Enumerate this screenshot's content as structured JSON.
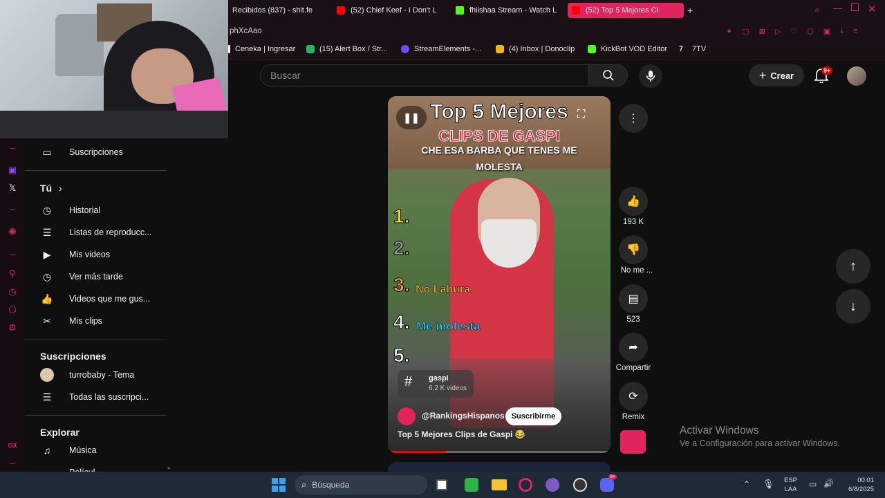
{
  "browser": {
    "tabs": [
      {
        "label": "Recibidos (837) - shit.fe"
      },
      {
        "label": "(52) Chief Keef - I Don't L"
      },
      {
        "label": "fhiishaa Stream - Watch L"
      },
      {
        "label": "(52) Top 5 Mejores Cl"
      }
    ],
    "address_fragment": "phXcAao",
    "bookmarks": [
      {
        "label": "Ceneka | Ingresar"
      },
      {
        "label": "(15) Alert Box / Str..."
      },
      {
        "label": "StreamElements -..."
      },
      {
        "label": "(4) Inbox | Donoclip"
      },
      {
        "label": "KickBot VOD Editor"
      },
      {
        "label": "7TV"
      }
    ]
  },
  "header": {
    "search_placeholder": "Buscar",
    "create_label": "Crear",
    "notif_badge": "9+"
  },
  "sidebar": {
    "subscriptions_top": "Suscripciones",
    "you_label": "Tú",
    "you_items": [
      {
        "label": "Historial",
        "icon": "history-icon"
      },
      {
        "label": "Listas de reproducc...",
        "icon": "playlist-icon"
      },
      {
        "label": "Mis videos",
        "icon": "video-icon"
      },
      {
        "label": "Ver más tarde",
        "icon": "clock-icon"
      },
      {
        "label": "Videos que me gus...",
        "icon": "thumbs-up-icon"
      },
      {
        "label": "Mis clips",
        "icon": "scissors-icon"
      }
    ],
    "subs_heading": "Suscripciones",
    "subs_items": [
      {
        "label": "turrobaby - Tema"
      },
      {
        "label": "Todas las suscripci..."
      }
    ],
    "explore_heading": "Explorar",
    "explore_items": [
      {
        "label": "Música"
      },
      {
        "label": "Películ..."
      }
    ]
  },
  "video": {
    "title_line1": "Top 5 Mejores",
    "title_line2": "CLIPS DE GASPI",
    "caption": "CHE ESA BARBA QUE TENES ME MOLESTA",
    "ranks": [
      {
        "num": "1.",
        "label": ""
      },
      {
        "num": "2.",
        "label": ""
      },
      {
        "num": "3.",
        "label": "No Labura"
      },
      {
        "num": "4.",
        "label": "Me molesta"
      },
      {
        "num": "5.",
        "label": ""
      }
    ],
    "hashtag": "gaspi",
    "hashtag_count": "6,2 K videos",
    "channel": "@RankingsHispanos",
    "subscribe_label": "Suscribirme",
    "short_title": "Top 5 Mejores Clips de Gaspi 😂",
    "progress": 0.26
  },
  "actions": {
    "likes": "193 K",
    "dislike_label": "No me ...",
    "comments": "523",
    "share_label": "Compartir",
    "remix_label": "Remix"
  },
  "watermark": {
    "line1": "Activar Windows",
    "line2": "Ve a Configuración para activar Windows."
  },
  "taskbar": {
    "search_placeholder": "Búsqueda",
    "lang1": "ESP",
    "lang2": "LAA",
    "time": "00:01",
    "date": "6/8/2025",
    "discord_badge": "9+"
  },
  "gx_label": "GX",
  "colors": {
    "accent": "#e0245e",
    "bg": "#0f0f0f",
    "green": "#49e649",
    "red": "#e8112d",
    "orange": "#f2a93b",
    "cyan": "#2ad1ff"
  }
}
